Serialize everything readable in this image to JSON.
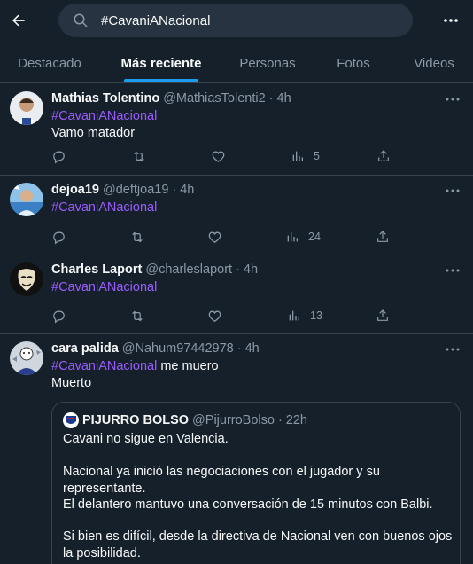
{
  "header": {
    "search_value": "#CavaniANacional"
  },
  "tabs": [
    {
      "label": "Destacado"
    },
    {
      "label": "Más reciente"
    },
    {
      "label": "Personas"
    },
    {
      "label": "Fotos"
    },
    {
      "label": "Videos"
    }
  ],
  "active_tab": "Más reciente",
  "colors": {
    "background": "#15202b",
    "accent": "#1d9bf0",
    "hashtag": "#9b5cff",
    "secondary_text": "#8b98a5",
    "divider": "#38444d"
  },
  "tweets": [
    {
      "name": "Mathias Tolentino",
      "handle": "@MathiasTolenti2",
      "time": "4h",
      "hashtag": "#CavaniANacional",
      "text_after": "",
      "text_line2": "Vamo matador",
      "retweets": "",
      "views": "5"
    },
    {
      "name": "dejoa19",
      "handle": "@deftjoa19",
      "time": "4h",
      "hashtag": "#CavaniANacional",
      "text_after": "",
      "text_line2": "",
      "views": "24"
    },
    {
      "name": "Charles Laport",
      "handle": "@charleslaport",
      "time": "4h",
      "hashtag": "#CavaniANacional",
      "text_after": "",
      "text_line2": "",
      "views": "13"
    },
    {
      "name": "cara palida",
      "handle": "@Nahum97442978",
      "time": "4h",
      "hashtag": "#CavaniANacional",
      "text_after": " me muero",
      "text_line2": "Muerto",
      "quote": {
        "name": "PIJURRO BOLSO",
        "handle": "@PijurroBolso",
        "time": "22h",
        "paragraphs": [
          "Cavani no sigue en Valencia.",
          "Nacional ya inició las negociaciones con el jugador y su representante.",
          "El delantero mantuvo una conversación de 15 minutos con Balbi.",
          "Si bien es difícil, desde la directiva de Nacional ven con buenos ojos la posibilidad."
        ]
      }
    }
  ],
  "separator": "·"
}
